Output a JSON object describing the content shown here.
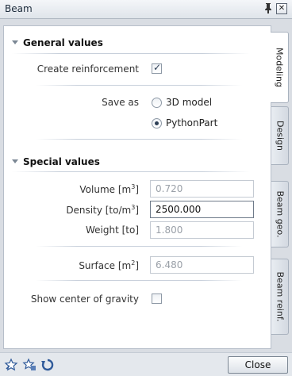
{
  "window": {
    "title": "Beam",
    "pin_glyph": "Ꮲ",
    "close_glyph": "✕"
  },
  "general": {
    "heading": "General values",
    "create_reinforcement_label": "Create reinforcement",
    "create_reinforcement_checked": true,
    "save_as_label": "Save as",
    "save_as_options": [
      {
        "label": "3D model",
        "selected": false
      },
      {
        "label": "PythonPart",
        "selected": true
      }
    ]
  },
  "special": {
    "heading": "Special values",
    "volume_label": "Volume [m",
    "volume_sup": "3",
    "volume_close": "]",
    "volume_value": "0.720",
    "density_label": "Density [to/m",
    "density_sup": "3",
    "density_close": "]",
    "density_value": "2500.000",
    "weight_label": "Weight [to]",
    "weight_value": "1.800",
    "surface_label": "Surface [m",
    "surface_sup": "2",
    "surface_close": "]",
    "surface_value": "6.480",
    "center_gravity_label": "Show center of gravity",
    "center_gravity_checked": false
  },
  "tabs": [
    "Modeling",
    "Design",
    "Beam geo.",
    "Beam reinf."
  ],
  "footer": {
    "close_label": "Close"
  },
  "colors": {
    "accent": "#2d3f55",
    "panel_bg": "#ffffff",
    "frame_bg": "#d9dde3"
  }
}
